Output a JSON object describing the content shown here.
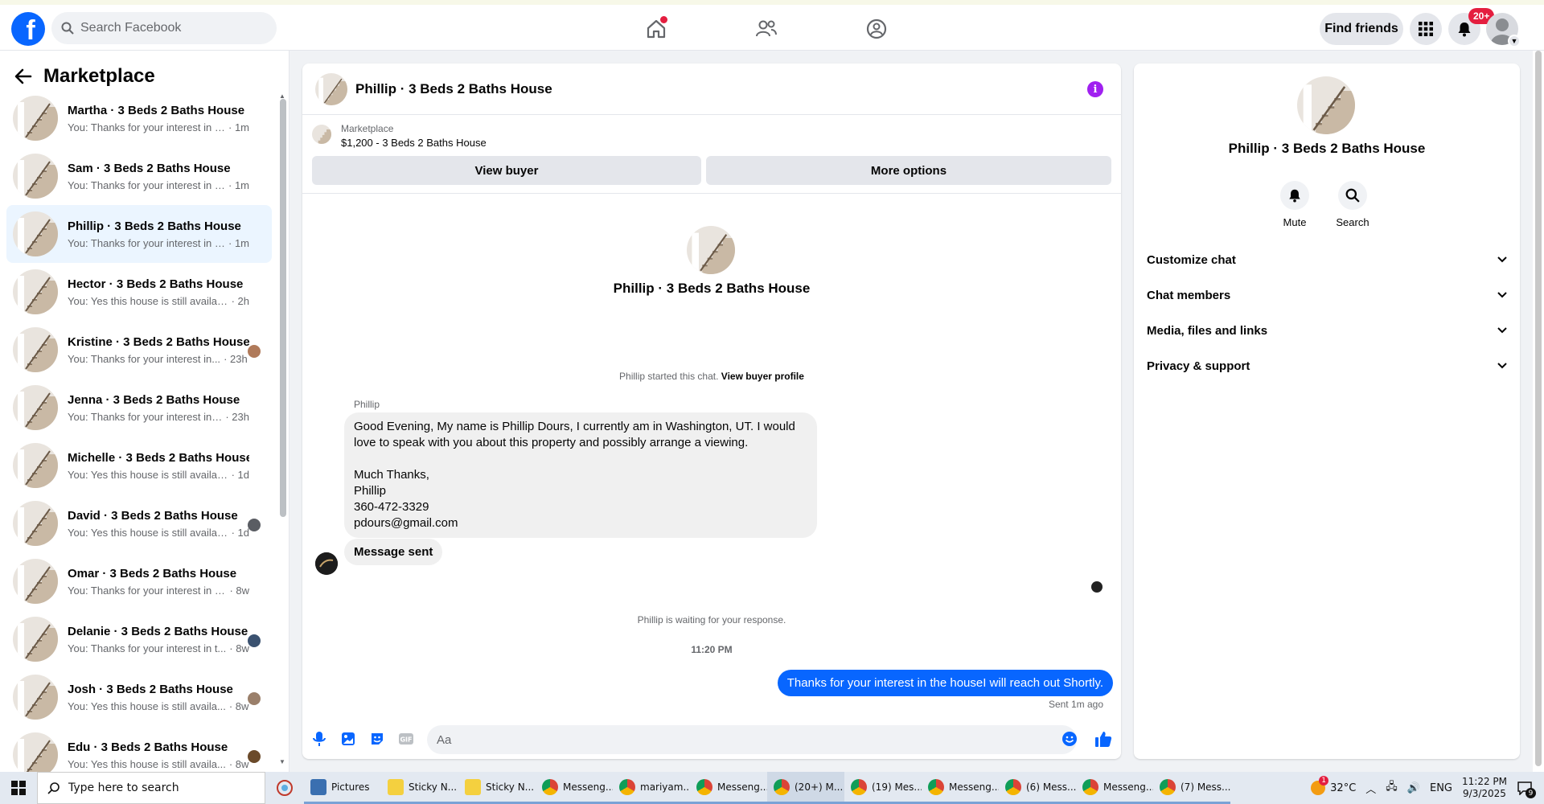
{
  "topbar": {
    "search_placeholder": "Search Facebook",
    "find_friends_label": "Find friends",
    "notifications_badge": "20+"
  },
  "sidebar": {
    "title": "Marketplace",
    "conversations": [
      {
        "name": "Martha · 3 Beds 2 Baths House",
        "preview": "You: Thanks for your interest in the...",
        "time": "· 1m"
      },
      {
        "name": "Sam · 3 Beds 2 Baths House",
        "preview": "You: Thanks for your interest in the...",
        "time": "· 1m"
      },
      {
        "name": "Phillip · 3 Beds 2 Baths House",
        "preview": "You: Thanks for your interest in the...",
        "time": "· 1m"
      },
      {
        "name": "Hector · 3 Beds 2 Baths House",
        "preview": "You: Yes this house is still available f...",
        "time": "· 2h"
      },
      {
        "name": "Kristine · 3 Beds 2 Baths House",
        "preview": "You: Thanks for your interest in...",
        "time": "· 23h"
      },
      {
        "name": "Jenna · 3 Beds 2 Baths House",
        "preview": "You: Thanks for your interest in th...",
        "time": "· 23h"
      },
      {
        "name": "Michelle · 3 Beds 2 Baths House",
        "preview": "You: Yes this house is still available ...",
        "time": "· 1d"
      },
      {
        "name": "David · 3 Beds 2 Baths House",
        "preview": "You: Yes this house is still availab...",
        "time": "· 1d"
      },
      {
        "name": "Omar · 3 Beds 2 Baths House",
        "preview": "You: Thanks for your interest in the...",
        "time": "· 8w"
      },
      {
        "name": "Delanie · 3 Beds 2 Baths House",
        "preview": "You: Thanks for your interest in t...",
        "time": "· 8w"
      },
      {
        "name": "Josh · 3 Beds 2 Baths House",
        "preview": "You: Yes this house is still availa...",
        "time": "· 8w"
      },
      {
        "name": "Edu · 3 Beds 2 Baths House",
        "preview": "You: Yes this house is still availa...",
        "time": "· 8w"
      }
    ]
  },
  "chat": {
    "title": "Phillip · 3 Beds 2 Baths House",
    "marketplace_label": "Marketplace",
    "listing": "$1,200 - 3 Beds 2 Baths House",
    "view_buyer_label": "View buyer",
    "more_options_label": "More options",
    "intro_name": "Phillip · 3 Beds 2 Baths House",
    "started_text": "Phillip started this chat.",
    "view_profile_label": "View buyer profile",
    "sender_name": "Phillip",
    "incoming_lines": [
      "Good Evening, My name is Phillip Dours, I currently am in Washington, UT.  I would love to speak with you about this property and possibly arrange a viewing.",
      "",
      "Much Thanks,",
      "Phillip",
      "360-472-3329",
      "pdours@gmail.com"
    ],
    "message_sent_label": "Message sent",
    "waiting_text": "Phillip is waiting for your response.",
    "time_stamp": "11:20 PM",
    "outgoing_text": "Thanks for your interest in the houseI will reach out Shortly.",
    "sent_ago": "Sent 1m ago",
    "composer_placeholder": "Aa"
  },
  "details": {
    "name": "Phillip · 3 Beds 2 Baths House",
    "mute_label": "Mute",
    "search_label": "Search",
    "sections": [
      "Customize chat",
      "Chat members",
      "Media, files and links",
      "Privacy & support"
    ]
  },
  "taskbar": {
    "search_placeholder": "Type here to search",
    "apps": [
      {
        "label": "Pictures"
      },
      {
        "label": "Sticky N..."
      },
      {
        "label": "Sticky N..."
      },
      {
        "label": "Messeng..."
      },
      {
        "label": "mariyam..."
      },
      {
        "label": "Messeng..."
      },
      {
        "label": "(20+) M..."
      },
      {
        "label": "(19) Mes..."
      },
      {
        "label": "Messeng..."
      },
      {
        "label": "(6) Mess..."
      },
      {
        "label": "Messeng..."
      },
      {
        "label": "(7) Mess..."
      }
    ],
    "weather": "32°C",
    "weather_badge": "1",
    "language": "ENG",
    "time": "11:22 PM",
    "date": "9/3/2025",
    "notification_count": "9"
  },
  "colors": {
    "accent": "#0866ff",
    "badge": "#e41e3f",
    "info_icon": "#a020f0"
  }
}
